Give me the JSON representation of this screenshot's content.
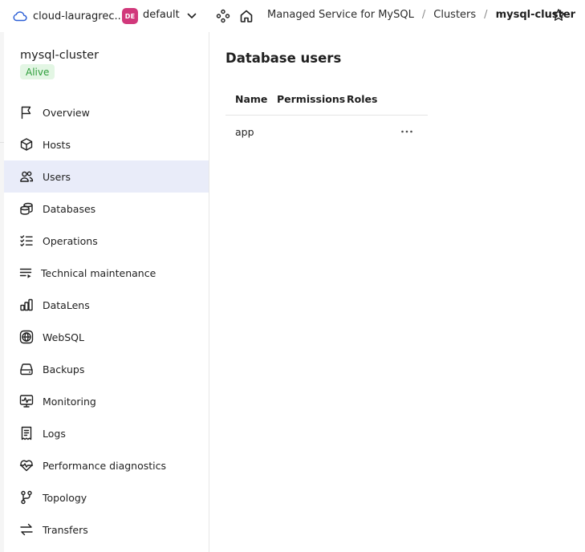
{
  "topbar": {
    "cloud_name": "cloud-lauragrec...",
    "folder_badge": "DE",
    "folder_name": "default",
    "breadcrumbs": [
      "Managed Service for MySQL",
      "Clusters",
      "mysql-cluster"
    ],
    "separator": "/"
  },
  "sidebar": {
    "cluster_name": "mysql-cluster",
    "status": "Alive",
    "items": [
      {
        "label": "Overview",
        "icon": "flag-icon"
      },
      {
        "label": "Hosts",
        "icon": "cube-icon"
      },
      {
        "label": "Users",
        "icon": "users-icon",
        "active": true
      },
      {
        "label": "Databases",
        "icon": "databases-icon"
      },
      {
        "label": "Operations",
        "icon": "list-check-icon"
      },
      {
        "label": "Technical maintenance",
        "icon": "list-play-icon"
      },
      {
        "label": "DataLens",
        "icon": "bar-chart-icon"
      },
      {
        "label": "WebSQL",
        "icon": "globe-icon"
      },
      {
        "label": "Backups",
        "icon": "hdd-icon"
      },
      {
        "label": "Monitoring",
        "icon": "monitor-pulse-icon"
      },
      {
        "label": "Logs",
        "icon": "receipt-icon"
      },
      {
        "label": "Performance diagnostics",
        "icon": "heart-pulse-icon"
      },
      {
        "label": "Topology",
        "icon": "branch-icon"
      },
      {
        "label": "Transfers",
        "icon": "arrows-exchange-icon"
      }
    ]
  },
  "main": {
    "title": "Database users",
    "table": {
      "headers": [
        "Name",
        "Permissions",
        "Roles"
      ],
      "rows": [
        {
          "name": "app",
          "permissions": "",
          "roles": ""
        }
      ]
    }
  },
  "colors": {
    "active_bg": "#e9ecf9",
    "status_bg": "#e3f6e4",
    "status_text": "#2d9e3a",
    "folder_badge_bg": "#d1387b"
  }
}
